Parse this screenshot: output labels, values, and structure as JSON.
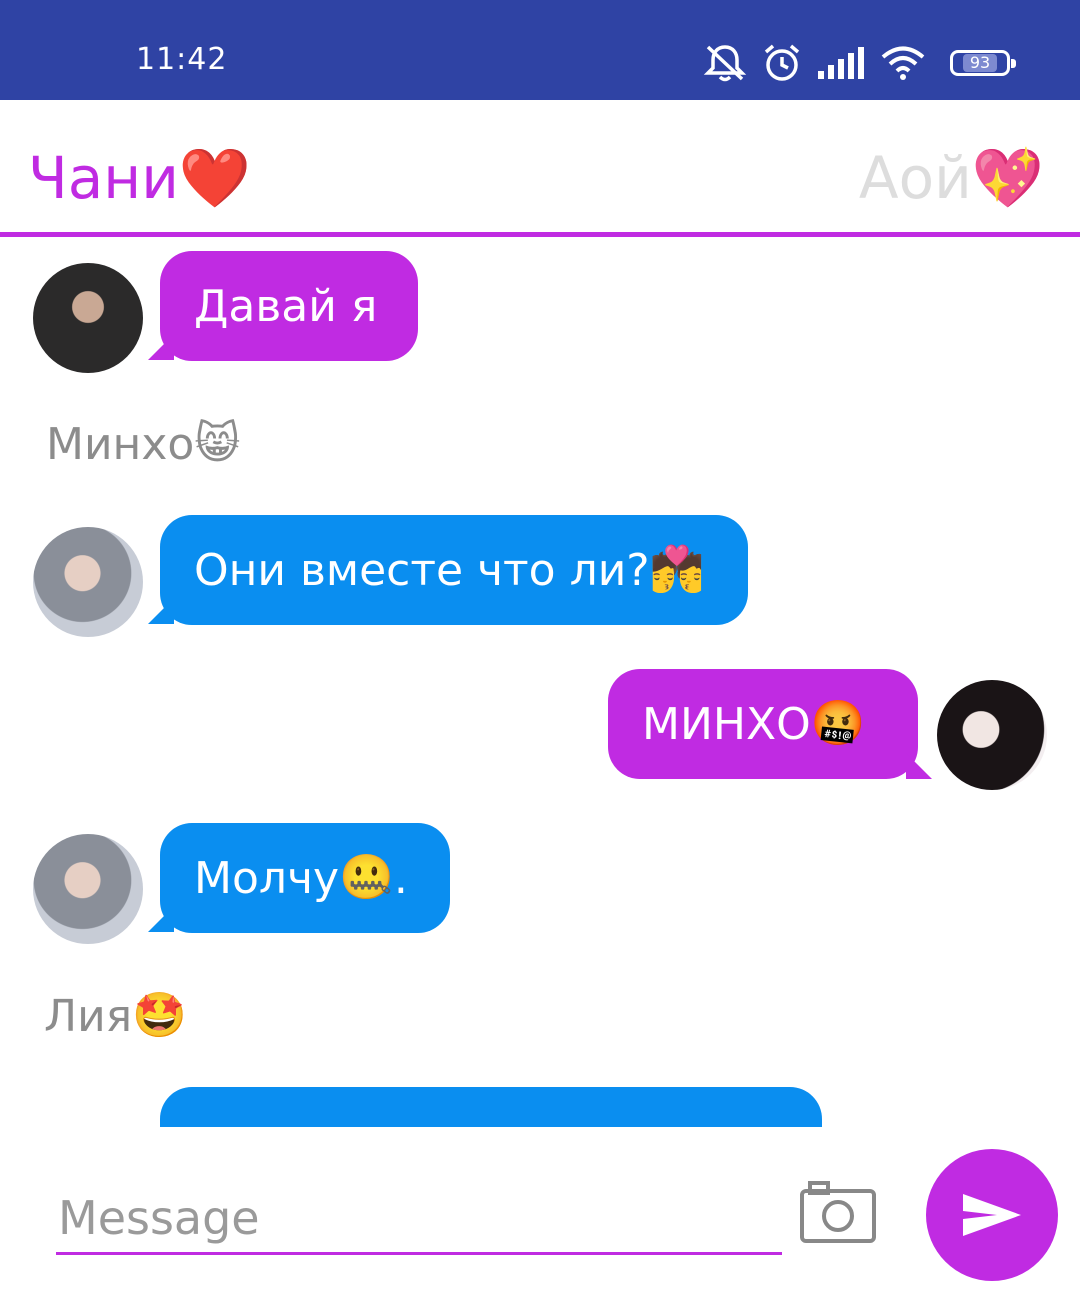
{
  "status_bar": {
    "time": "11:42",
    "battery": "93",
    "icons": [
      "mute-bell-icon",
      "alarm-icon",
      "signal-icon",
      "wifi-icon",
      "battery-icon"
    ]
  },
  "header": {
    "active_name": "Чани",
    "active_emoji": "❤️",
    "inactive_name": "Аой",
    "inactive_emoji": "💖"
  },
  "messages": [
    {
      "type": "bubble",
      "side": "left",
      "color": "purple",
      "text": "Давай я"
    },
    {
      "type": "sender",
      "name": "Минхо",
      "emoji": "😸"
    },
    {
      "type": "bubble",
      "side": "left",
      "color": "blue",
      "text": "Они вместе что ли?",
      "emoji": "💏"
    },
    {
      "type": "bubble",
      "side": "right",
      "color": "purple",
      "text": "МИНХО",
      "emoji": "🤬"
    },
    {
      "type": "bubble",
      "side": "left",
      "color": "blue",
      "text": "Молчу",
      "emoji": "🤐",
      "suffix": "."
    },
    {
      "type": "sender",
      "name": "Лия",
      "emoji": "🤩"
    }
  ],
  "input": {
    "placeholder": "Message"
  },
  "colors": {
    "status_bar": "#2f43a4",
    "accent_purple": "#c02be2",
    "bubble_blue": "#0a8ef0",
    "sender_gray": "#8c8c8c",
    "inactive_tab": "#dddddd"
  }
}
